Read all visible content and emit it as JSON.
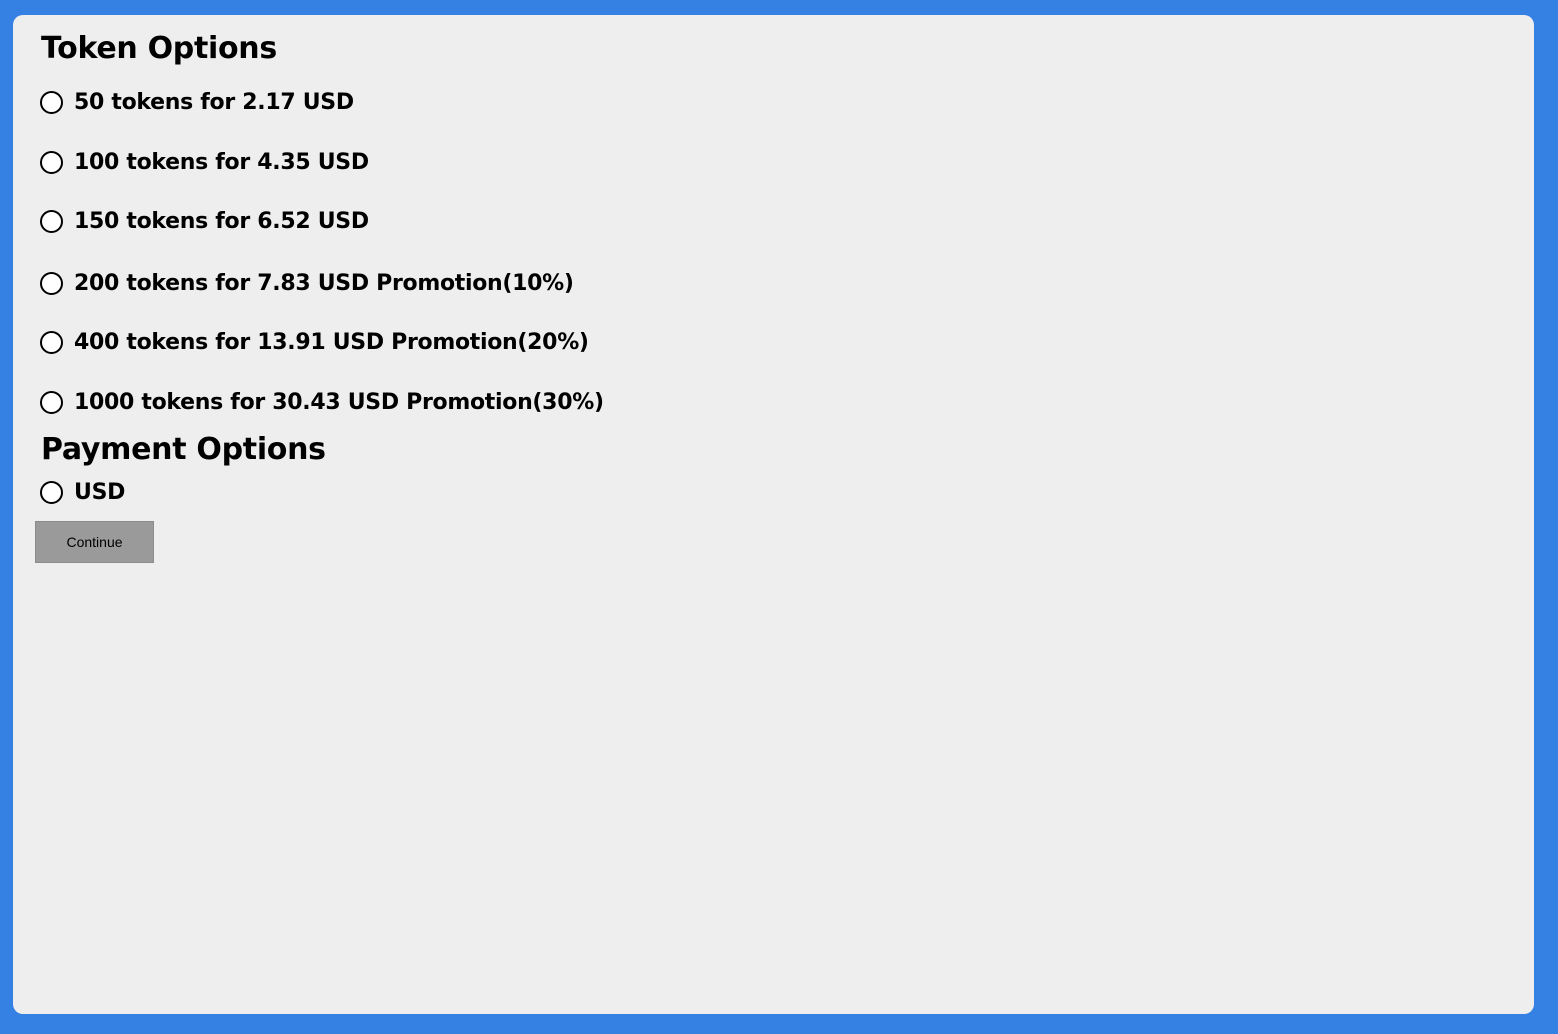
{
  "token_section": {
    "title": "Token Options",
    "options": [
      {
        "label": "50 tokens for 2.17 USD",
        "selected": false
      },
      {
        "label": "100 tokens for 4.35 USD",
        "selected": false
      },
      {
        "label": "150 tokens for 6.52 USD",
        "selected": false
      },
      {
        "label": "200 tokens for 7.83 USD Promotion(10%)",
        "selected": false
      },
      {
        "label": "400 tokens for 13.91 USD Promotion(20%)",
        "selected": false
      },
      {
        "label": "1000 tokens for 30.43 USD Promotion(30%)",
        "selected": false
      }
    ]
  },
  "payment_section": {
    "title": "Payment Options",
    "options": [
      {
        "label": "USD",
        "selected": false
      }
    ]
  },
  "continue_button": {
    "label": "Continue"
  },
  "colors": {
    "page_background": "#3580e3",
    "panel_background": "#efeeee",
    "button_background": "#9a9a9a"
  }
}
